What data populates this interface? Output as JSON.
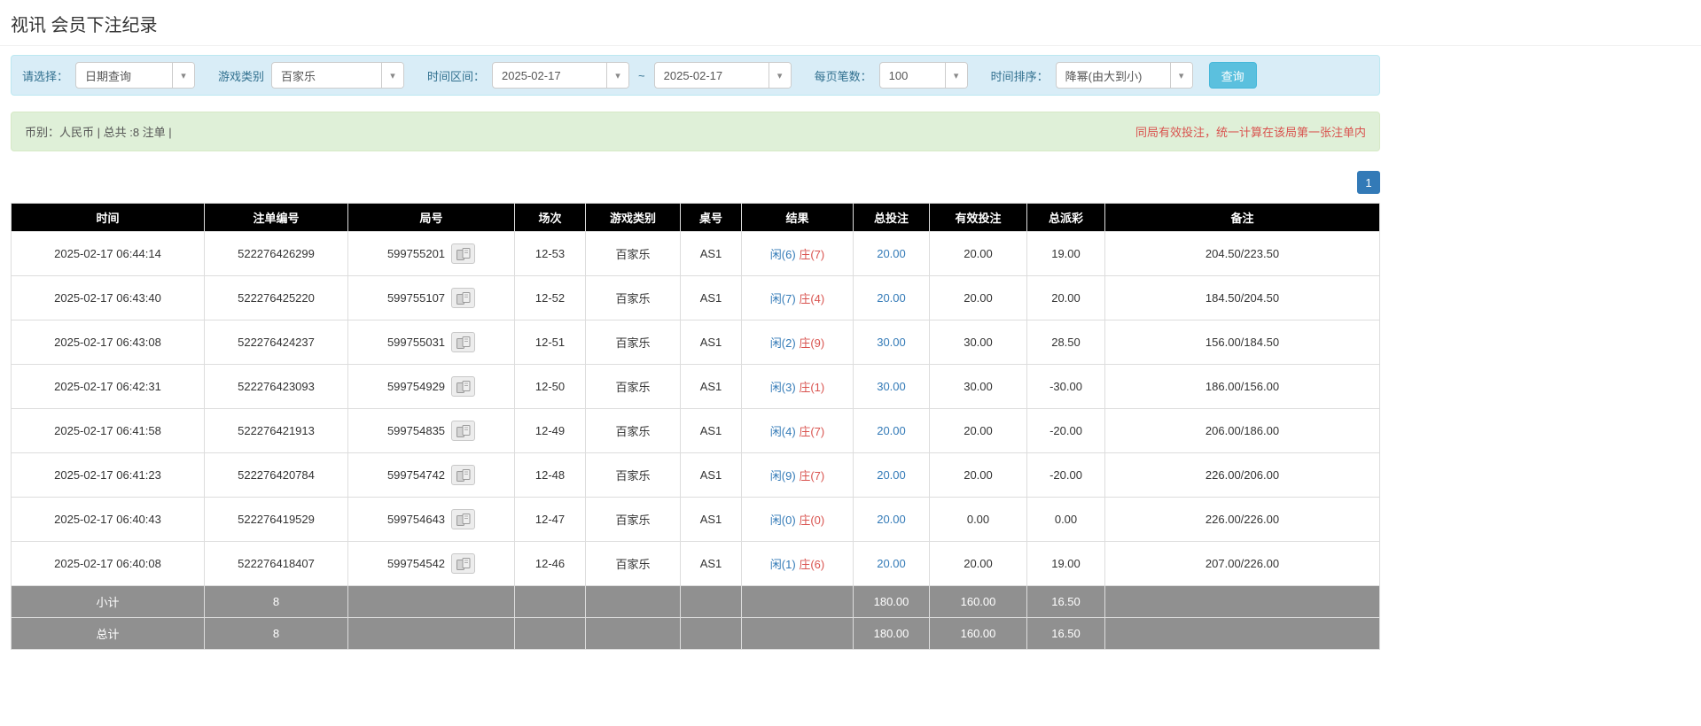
{
  "page": {
    "title": "视讯 会员下注纪录"
  },
  "filters": {
    "query_type_label": "请选择：",
    "query_type_value": "日期查询",
    "game_label": "游戏类别",
    "game_value": "百家乐",
    "range_label": "时间区间：",
    "date_from": "2025-02-17",
    "range_separator": "~",
    "date_to": "2025-02-17",
    "page_size_label": "每页笔数：",
    "page_size_value": "100",
    "sort_label": "时间排序：",
    "sort_value": "降幂(由大到小)",
    "search_button": "查询"
  },
  "notice_bar": {
    "left_text": "币别：人民币 | 总共 :8 注单 |",
    "right_notice": "同局有效投注，统一计算在该局第一张注单内"
  },
  "pagination": {
    "pages": [
      "1"
    ]
  },
  "table": {
    "headers": [
      "时间",
      "注单编号",
      "局号",
      "场次",
      "游戏类别",
      "桌号",
      "结果",
      "总投注",
      "有效投注",
      "总派彩",
      "备注"
    ],
    "rows": [
      {
        "time": "2025-02-17 06:44:14",
        "bet_id": "522276426299",
        "round_id": "599755201",
        "session": "12-53",
        "game": "百家乐",
        "table_no": "AS1",
        "player": "闲(6)",
        "banker": "庄(7)",
        "total_bet": "20.00",
        "valid_bet": "20.00",
        "payout": "19.00",
        "remark": "204.50/223.50"
      },
      {
        "time": "2025-02-17 06:43:40",
        "bet_id": "522276425220",
        "round_id": "599755107",
        "session": "12-52",
        "game": "百家乐",
        "table_no": "AS1",
        "player": "闲(7)",
        "banker": "庄(4)",
        "total_bet": "20.00",
        "valid_bet": "20.00",
        "payout": "20.00",
        "remark": "184.50/204.50"
      },
      {
        "time": "2025-02-17 06:43:08",
        "bet_id": "522276424237",
        "round_id": "599755031",
        "session": "12-51",
        "game": "百家乐",
        "table_no": "AS1",
        "player": "闲(2)",
        "banker": "庄(9)",
        "total_bet": "30.00",
        "valid_bet": "30.00",
        "payout": "28.50",
        "remark": "156.00/184.50"
      },
      {
        "time": "2025-02-17 06:42:31",
        "bet_id": "522276423093",
        "round_id": "599754929",
        "session": "12-50",
        "game": "百家乐",
        "table_no": "AS1",
        "player": "闲(3)",
        "banker": "庄(1)",
        "total_bet": "30.00",
        "valid_bet": "30.00",
        "payout": "-30.00",
        "remark": "186.00/156.00"
      },
      {
        "time": "2025-02-17 06:41:58",
        "bet_id": "522276421913",
        "round_id": "599754835",
        "session": "12-49",
        "game": "百家乐",
        "table_no": "AS1",
        "player": "闲(4)",
        "banker": "庄(7)",
        "total_bet": "20.00",
        "valid_bet": "20.00",
        "payout": "-20.00",
        "remark": "206.00/186.00"
      },
      {
        "time": "2025-02-17 06:41:23",
        "bet_id": "522276420784",
        "round_id": "599754742",
        "session": "12-48",
        "game": "百家乐",
        "table_no": "AS1",
        "player": "闲(9)",
        "banker": "庄(7)",
        "total_bet": "20.00",
        "valid_bet": "20.00",
        "payout": "-20.00",
        "remark": "226.00/206.00"
      },
      {
        "time": "2025-02-17 06:40:43",
        "bet_id": "522276419529",
        "round_id": "599754643",
        "session": "12-47",
        "game": "百家乐",
        "table_no": "AS1",
        "player": "闲(0)",
        "banker": "庄(0)",
        "total_bet": "20.00",
        "valid_bet": "0.00",
        "payout": "0.00",
        "remark": "226.00/226.00"
      },
      {
        "time": "2025-02-17 06:40:08",
        "bet_id": "522276418407",
        "round_id": "599754542",
        "session": "12-46",
        "game": "百家乐",
        "table_no": "AS1",
        "player": "闲(1)",
        "banker": "庄(6)",
        "total_bet": "20.00",
        "valid_bet": "20.00",
        "payout": "19.00",
        "remark": "207.00/226.00"
      }
    ],
    "footer_rows": [
      {
        "label": "小计",
        "count": "8",
        "total_bet": "180.00",
        "valid_bet": "160.00",
        "payout": "16.50"
      },
      {
        "label": "总计",
        "count": "8",
        "total_bet": "180.00",
        "valid_bet": "160.00",
        "payout": "16.50"
      }
    ]
  },
  "colors": {
    "header_bg": "#000000",
    "summary_row_bg": "#909090",
    "filter_bar_bg": "#d9edf7",
    "notice_bar_bg": "#dff0d8",
    "accent_blue": "#337ab7",
    "query_button_blue": "#5bc0de",
    "alert_red": "#d9534f"
  }
}
